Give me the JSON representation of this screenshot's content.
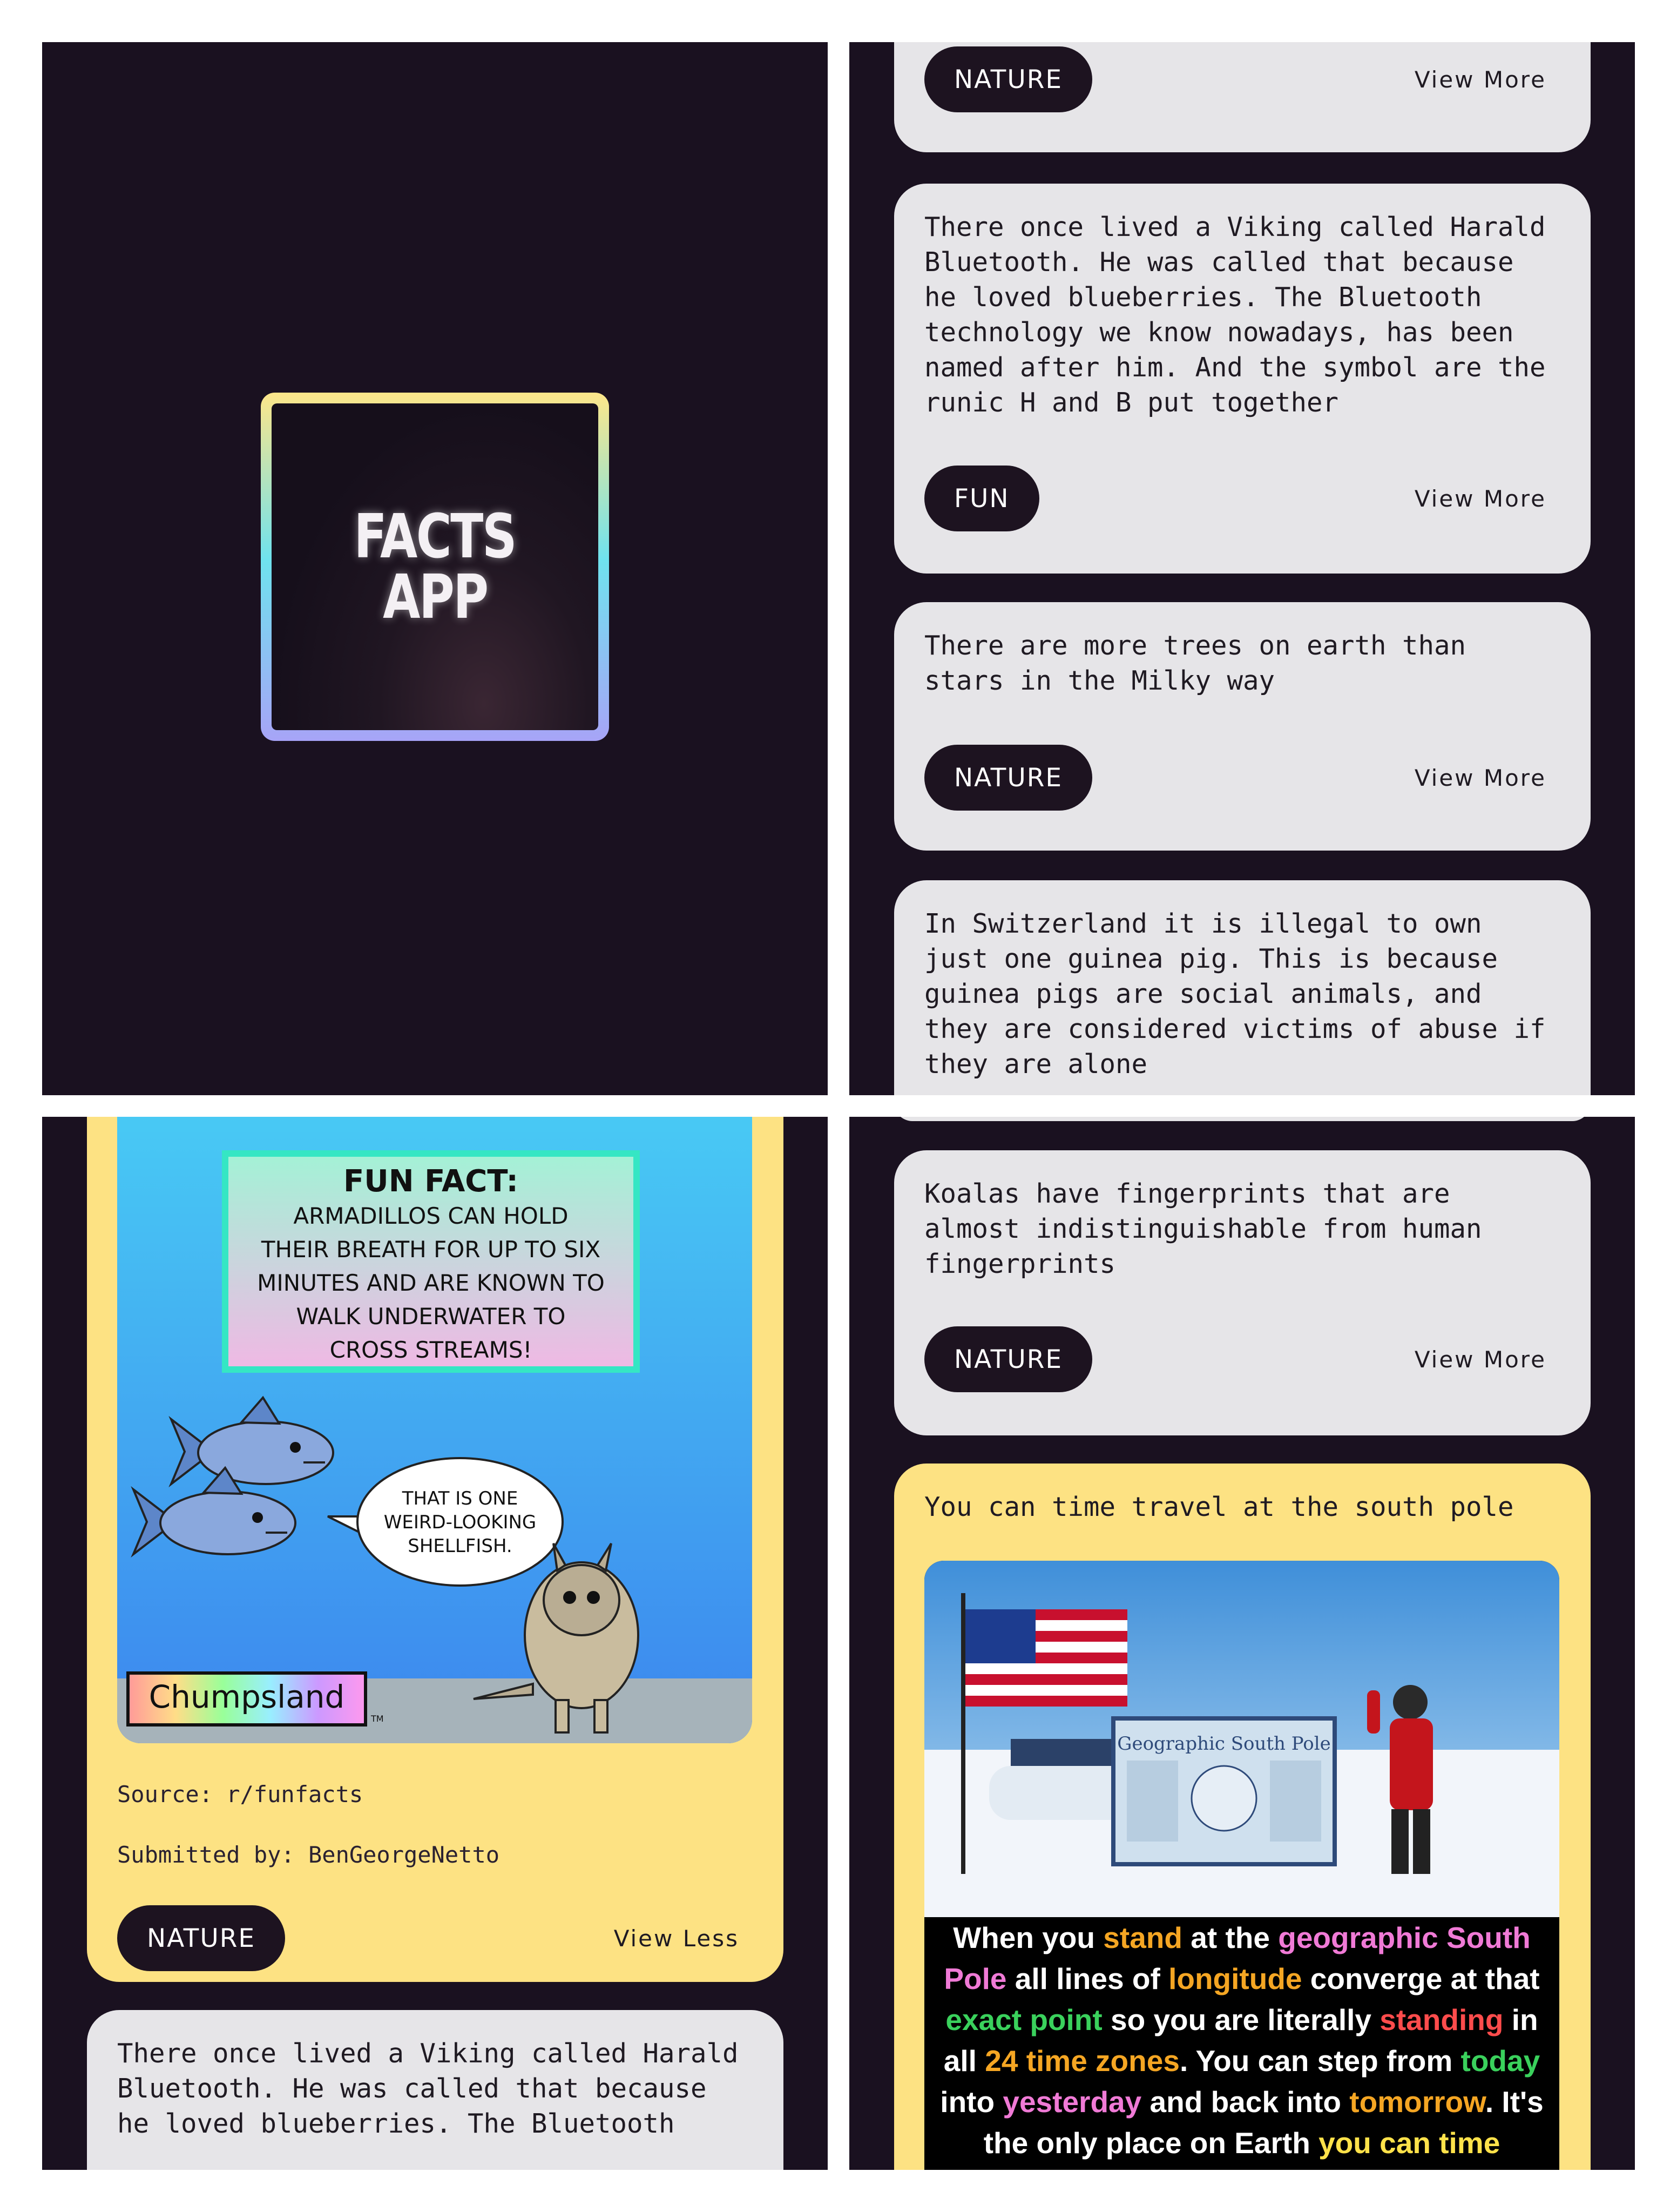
{
  "splash": {
    "logo_line1": "FACTS",
    "logo_line2": "APP"
  },
  "feed": {
    "partial_top_card": {
      "category": "NATURE",
      "action": "View More"
    },
    "cards": [
      {
        "text": "There once lived a Viking called Harald Bluetooth. He was called that because he loved blueberries. The Bluetooth technology we know nowadays, has been named after him. And the symbol are the runic H and B put together",
        "category": "FUN",
        "action": "View More"
      },
      {
        "text": "There are more trees on earth than stars in the Milky way",
        "category": "NATURE",
        "action": "View More"
      },
      {
        "text": "In Switzerland it is illegal to own just one guinea pig. This is because guinea pigs are social animals, and they are considered victims of abuse if they are alone",
        "category": "",
        "action": ""
      }
    ]
  },
  "expanded_card": {
    "image": {
      "header": "FUN FACT:",
      "body_lines": [
        "ARMADILLOS CAN HOLD",
        "THEIR BREATH FOR UP TO SIX",
        "MINUTES AND ARE KNOWN TO",
        "WALK UNDERWATER TO",
        "CROSS STREAMS!"
      ],
      "speech_lines": [
        "THAT IS ONE",
        "WEIRD-LOOKING",
        "SHELLFISH."
      ],
      "brand": "Chumpsland",
      "trademark": "TM"
    },
    "source": "Source: r/funfacts",
    "submitted_by": "Submitted by: BenGeorgeNetto",
    "category": "NATURE",
    "action": "View Less",
    "next_card_text": "There once lived a Viking called Harald Bluetooth. He was called that because he loved blueberries. The Bluetooth"
  },
  "feed2": {
    "card": {
      "text": "Koalas have fingerprints that are almost indistinguishable from human fingerprints",
      "category": "NATURE",
      "action": "View More"
    },
    "photo_card": {
      "title": "You can time travel at the south pole",
      "sign_title": "Geographic South Pole",
      "caption": {
        "s1": "When you ",
        "h1": "stand",
        "s2": " at the ",
        "h2": "geographic South Pole",
        "s3": " all lines of ",
        "h3": "longitude",
        "s4": " converge at that ",
        "h4": "exact point",
        "s5": " so you are literally ",
        "h5": "standing",
        "s6": " in all ",
        "h6": "24 time zones",
        "s7": ". You can step from ",
        "h7": "today",
        "s8": " into ",
        "h8": "yesterday",
        "s9": " and back into ",
        "h9": "tomorrow",
        "s10": ". It's the only place on Earth ",
        "h10": "you can time travel",
        "s11": "."
      }
    }
  }
}
